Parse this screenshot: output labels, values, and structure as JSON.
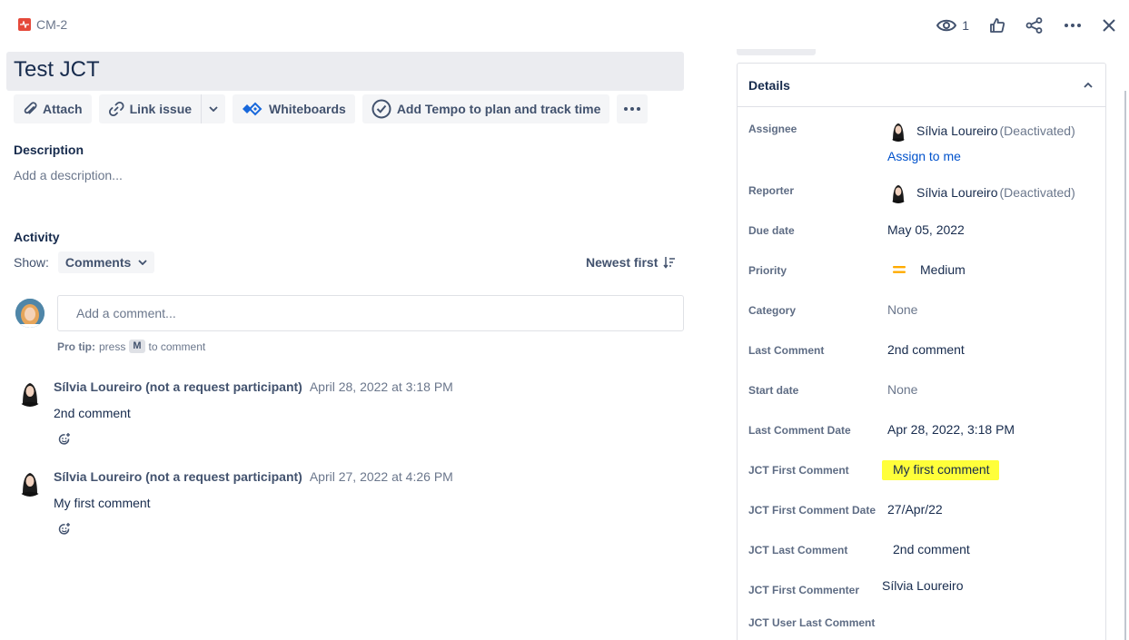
{
  "header": {
    "issue_key": "CM-2",
    "watch_count": "1"
  },
  "issue": {
    "title": "Test JCT"
  },
  "toolbar": {
    "attach": "Attach",
    "link_issue": "Link issue",
    "whiteboards": "Whiteboards",
    "tempo": "Add Tempo to plan and track time"
  },
  "description": {
    "label": "Description",
    "placeholder": "Add a description..."
  },
  "activity": {
    "label": "Activity",
    "show_label": "Show:",
    "filter": "Comments",
    "sort": "Newest first",
    "comment_placeholder": "Add a comment...",
    "protip_bold": "Pro tip:",
    "protip_press": "press",
    "protip_key": "M",
    "protip_rest": "to comment",
    "comments": [
      {
        "author": "Sílvia Loureiro (not a request participant)",
        "date": "April 28, 2022 at 3:18 PM",
        "body": "2nd comment"
      },
      {
        "author": "Sílvia Loureiro (not a request participant)",
        "date": "April 27, 2022 at 4:26 PM",
        "body": "My first comment"
      }
    ]
  },
  "details": {
    "title": "Details",
    "assignee_label": "Assignee",
    "assignee_name": "Sílvia Loureiro",
    "assignee_status": "(Deactivated)",
    "assign_to_me": "Assign to me",
    "reporter_label": "Reporter",
    "reporter_name": "Sílvia Loureiro",
    "reporter_status": "(Deactivated)",
    "due_label": "Due date",
    "due_value": "May 05, 2022",
    "priority_label": "Priority",
    "priority_value": "Medium",
    "category_label": "Category",
    "category_value": "None",
    "last_comment_label": "Last Comment",
    "last_comment_value": "2nd comment",
    "start_label": "Start date",
    "start_value": "None",
    "last_comment_date_label": "Last Comment Date",
    "last_comment_date_value": "Apr 28, 2022, 3:18 PM",
    "jct_first_comment_label": "JCT First Comment",
    "jct_first_comment_value": "My first comment",
    "jct_first_comment_date_label": "JCT First Comment Date",
    "jct_first_comment_date_value": "27/Apr/22",
    "jct_last_comment_label": "JCT Last Comment",
    "jct_last_comment_value": "2nd comment",
    "jct_first_commenter_label": "JCT First Commenter",
    "jct_first_commenter_value": "Sílvia Loureiro",
    "jct_user_last_comment_label": "JCT User Last Comment"
  },
  "colors": {
    "issue_type": "#e5493a",
    "priority_medium": "#ffab00",
    "highlight": "#ffff3a",
    "link": "#0052cc",
    "whiteboards_icon": "#1868db"
  },
  "icons": [
    "issue-type-icon",
    "eye-icon",
    "thumbs-up-icon",
    "share-icon",
    "more-icon",
    "close-icon",
    "paperclip-icon",
    "link-icon",
    "chevron-down-icon",
    "whiteboards-icon",
    "tempo-check-icon",
    "sort-icon",
    "add-reaction-icon",
    "chevron-up-icon",
    "priority-medium-icon"
  ]
}
